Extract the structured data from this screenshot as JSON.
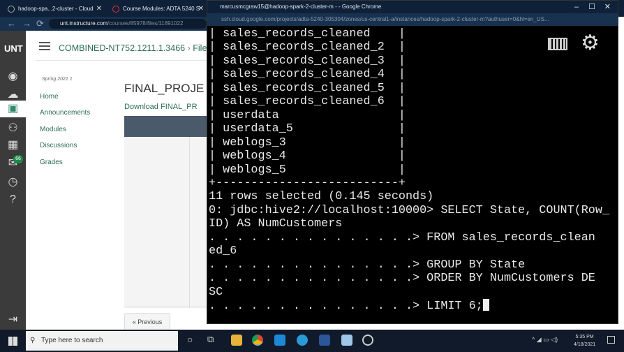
{
  "browser_tabs": [
    {
      "label": "hadoop-spa...2-cluster - Cloud"
    },
    {
      "label": "Course Modules: ADTA 5240 S"
    },
    {
      "label": "marcusmcgraw15@hadoop-spark-2-cluster-m - - Google Chrome"
    }
  ],
  "left_url": {
    "host": "unt.instructure.com",
    "path": "/courses/85978/files/11891022"
  },
  "right_url": "ssh.cloud.google.com/projects/adta-5240-305304/zones/us-central1-a/instances/hadoop-spark-2-cluster-m?authuser=0&hl=en_US...",
  "window_controls": {
    "minimize": "–",
    "maximize": "☐",
    "close": "✕"
  },
  "canvas": {
    "logo": "UNT",
    "breadcrumb": "COMBINED-NT752.1211.1.3466",
    "breadcrumb_next": "Files",
    "term": "Spring 2021 1",
    "nav": [
      "Home",
      "Announcements",
      "Modules",
      "Discussions",
      "Grades"
    ],
    "badge": "66",
    "page_title": "FINAL_PROJE",
    "download_link": "Download FINAL_PR",
    "previous_button": "« Previous"
  },
  "terminal": {
    "lines": [
      "| sales_records_cleaned    |",
      "| sales_records_cleaned_2  |",
      "| sales_records_cleaned_3  |",
      "| sales_records_cleaned_4  |",
      "| sales_records_cleaned_5  |",
      "| sales_records_cleaned_6  |",
      "| userdata                 |",
      "| userdata_5               |",
      "| weblogs_3                |",
      "| weblogs_4                |",
      "| weblogs_5                |",
      "+--------------------------+",
      "11 rows selected (0.145 seconds)",
      "0: jdbc:hive2://localhost:10000> SELECT State, COUNT(Row_",
      "ID) AS NumCustomers",
      ". . . . . . . . . . . . . . .> FROM sales_records_clean",
      "ed_6",
      ". . . . . . . . . . . . . . .> GROUP BY State",
      ". . . . . . . . . . . . . . .> ORDER BY NumCustomers DE",
      "SC",
      ". . . . . . . . . . . . . . .> LIMIT 6;"
    ]
  },
  "taskbar": {
    "search_placeholder": "Type here to search",
    "time": "5:35 PM",
    "date": "4/18/2021"
  }
}
